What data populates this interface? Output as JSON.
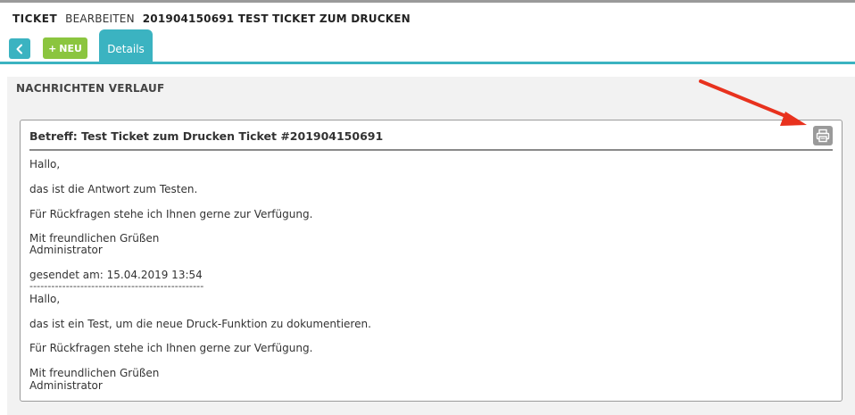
{
  "header": {
    "ticket_label": "TICKET",
    "edit_label": "BEARBEITEN",
    "ticket_title": "201904150691 TEST TICKET ZUM DRUCKEN"
  },
  "toolbar": {
    "back_icon": "chevron-left-icon",
    "new_plus": "+",
    "new_label": "NEU",
    "tab_details": "Details"
  },
  "panel": {
    "title": "NACHRICHTEN VERLAUF"
  },
  "message": {
    "subject": "Betreff: Test Ticket zum Drucken Ticket #201904150691",
    "print_icon": "printer-icon",
    "lines": [
      "Hallo,",
      "das ist die Antwort zum Testen.",
      "Für Rückfragen stehe ich Ihnen gerne zur Verfügung.",
      "Mit freundlichen Grüßen",
      "Administrator",
      "gesendet am: 15.04.2019 13:54",
      "------------------------------------------------",
      "Hallo,",
      "das ist ein Test, um die neue Druck-Funktion zu dokumentieren.",
      "Für Rückfragen stehe ich Ihnen gerne zur Verfügung.",
      "Mit freundlichen Grüßen",
      "Administrator"
    ]
  },
  "colors": {
    "accent": "#3bb3c1",
    "new_button": "#8bc53f",
    "annotation_arrow": "#e8321e"
  }
}
